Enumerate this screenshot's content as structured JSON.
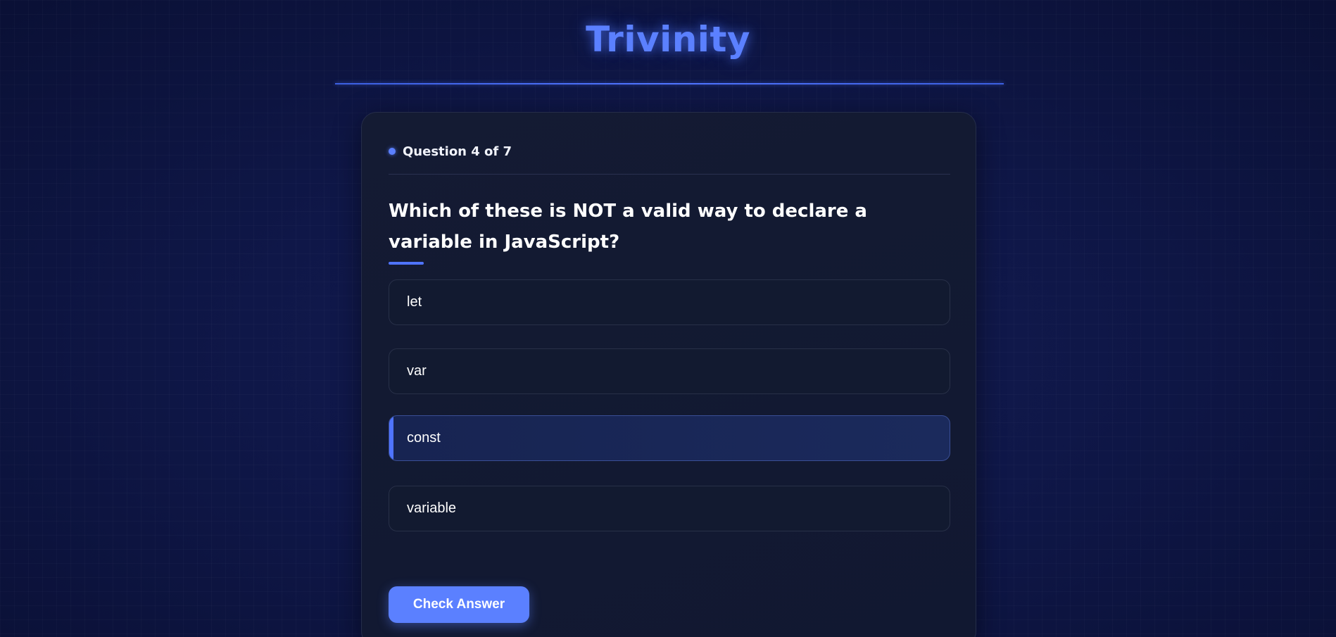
{
  "app": {
    "title": "Trivinity"
  },
  "quiz": {
    "progress_label": "Question 4 of 7",
    "current_question": 4,
    "total_questions": 7,
    "question": "Which of these is NOT a valid way to declare a variable in JavaScript?",
    "options": [
      {
        "label": "let",
        "selected": false
      },
      {
        "label": "var",
        "selected": false
      },
      {
        "label": "const",
        "selected": true
      },
      {
        "label": "variable",
        "selected": false
      }
    ],
    "check_button_label": "Check Answer"
  },
  "colors": {
    "accent": "#5b80ff",
    "background": "#0d1440",
    "card": "#121a30",
    "selected_option": "#1b2a5c"
  }
}
